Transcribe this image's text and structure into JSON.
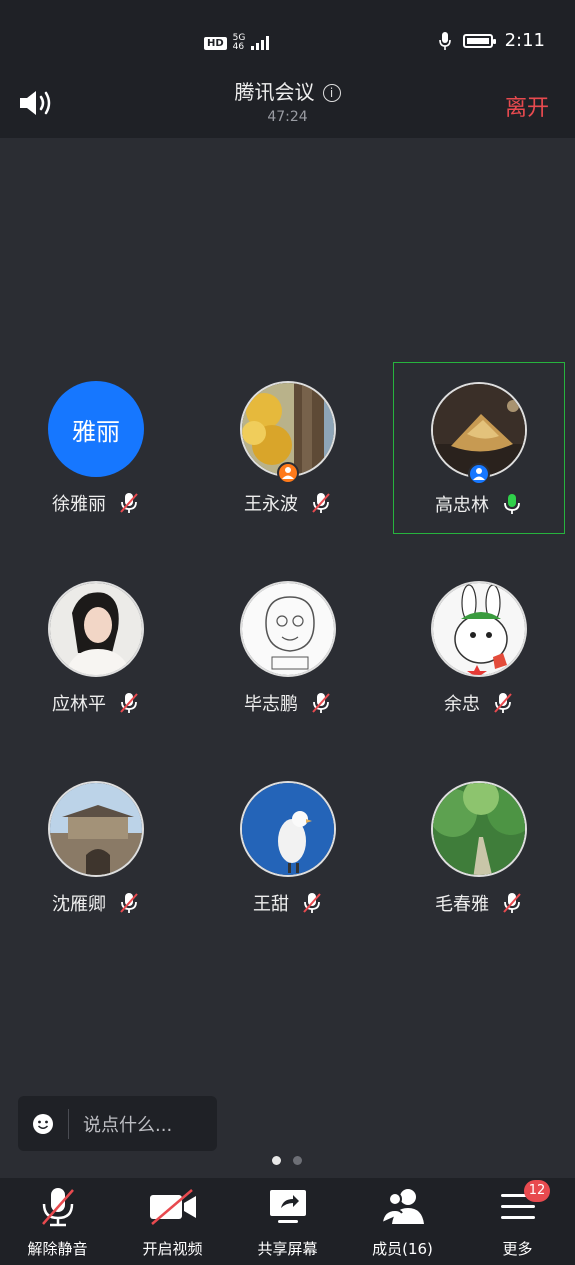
{
  "status_bar": {
    "hd": "HD",
    "network_top": "5G",
    "network_bottom": "46",
    "time": "2:11"
  },
  "header": {
    "title": "腾讯会议",
    "elapsed": "47:24",
    "leave_label": "离开"
  },
  "participants": [
    {
      "name": "徐雅丽",
      "avatar_text": "雅丽",
      "avatar_kind": "text",
      "mic": "muted"
    },
    {
      "name": "王永波",
      "avatar_kind": "photo-yellow-leaves",
      "mic": "muted",
      "role_badge": "host"
    },
    {
      "name": "高忠林",
      "avatar_kind": "photo-zongzi",
      "mic": "on",
      "role_badge": "cohost",
      "active_speaker": true
    },
    {
      "name": "应林平",
      "avatar_kind": "photo-woman",
      "mic": "muted"
    },
    {
      "name": "毕志鹏",
      "avatar_kind": "sketch-old-man",
      "mic": "muted"
    },
    {
      "name": "余忠",
      "avatar_kind": "cartoon-rabbit",
      "mic": "muted"
    },
    {
      "name": "沈雁卿",
      "avatar_kind": "photo-city-gate",
      "mic": "muted"
    },
    {
      "name": "王甜",
      "avatar_kind": "photo-white-bird",
      "mic": "muted"
    },
    {
      "name": "毛春雅",
      "avatar_kind": "photo-forest-path",
      "mic": "muted"
    }
  ],
  "chat": {
    "placeholder": "说点什么..."
  },
  "pager": {
    "pages": 2,
    "current": 1
  },
  "toolbar": [
    {
      "label": "解除静音",
      "icon": "mic-muted-icon"
    },
    {
      "label": "开启视频",
      "icon": "camera-off-icon"
    },
    {
      "label": "共享屏幕",
      "icon": "share-screen-icon"
    },
    {
      "label": "成员(16)",
      "icon": "members-icon"
    },
    {
      "label": "更多",
      "icon": "more-menu-icon"
    }
  ],
  "more_badge": "12",
  "colors": {
    "bg": "#2b2d33",
    "bar": "#1f2126",
    "leave": "#e84a4f",
    "accent_blue": "#1677ff",
    "active_green": "#27b33e"
  }
}
